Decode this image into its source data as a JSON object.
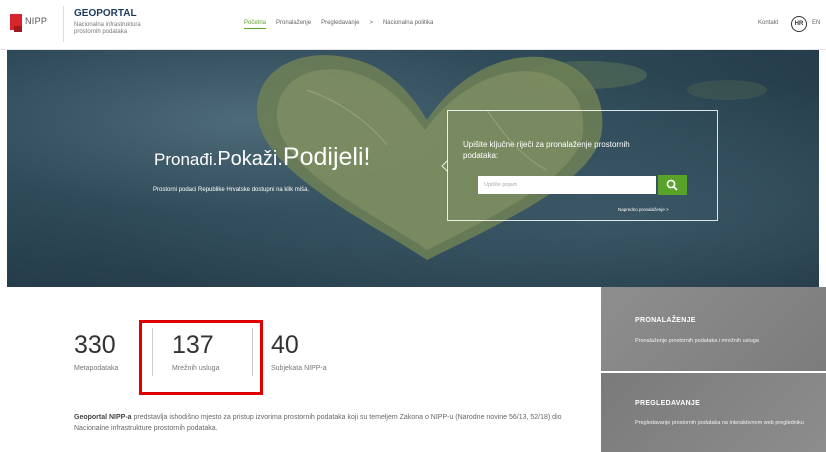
{
  "header": {
    "logo_text": "NIPP",
    "brand_title": "GEOPORTAL",
    "brand_subtitle": "Nacionalna infrastruktura prostornih podataka",
    "nav": [
      "Početna",
      "Pronalaženje",
      "Pregledavanje",
      "Nacionalna politika"
    ],
    "nav_active_index": 0,
    "nav_chevron": ">",
    "kontakt": "Kontakt",
    "lang_active": "HR",
    "lang_other": "EN"
  },
  "hero": {
    "heading_part1": "Pronađi.",
    "heading_part2": "Pokaži.",
    "heading_part3": "Podijeli!",
    "subtitle": "Prostorni podaci Republike Hrvatske dostupni na klik miša.",
    "search_title": "Upišite ključne riječi za pronalaženje prostornih podataka:",
    "search_placeholder": "Upišite pojam",
    "advanced_link": "Napredno pronalaženje >",
    "search_icon": "search-icon"
  },
  "stats": [
    {
      "value": "330",
      "label": "Metapodataka"
    },
    {
      "value": "137",
      "label": "Mrežnih usluga"
    },
    {
      "value": "40",
      "label": "Subjekata NIPP-a"
    }
  ],
  "description": {
    "bold": "Geoportal NIPP-a",
    "text": " predstavlja ishodišno mjesto za pristup izvorima prostornih podataka koji su temeljem Zakona o NIPP-u (Narodne novine 56/13, 52/18) dio Nacionalne infrastrukture prostornih podataka."
  },
  "panels": [
    {
      "title": "PRONALAŽENJE",
      "desc": "Pronalaženje prostornih podataka i mrežnih usluga"
    },
    {
      "title": "PREGLEDAVANJE",
      "desc": "Pregledavanje prostornih podataka na interaktivnom web pregledniku"
    }
  ],
  "colors": {
    "accent_green": "#5aa32a",
    "brand_red": "#d8232a",
    "highlight_red": "#e00000"
  }
}
